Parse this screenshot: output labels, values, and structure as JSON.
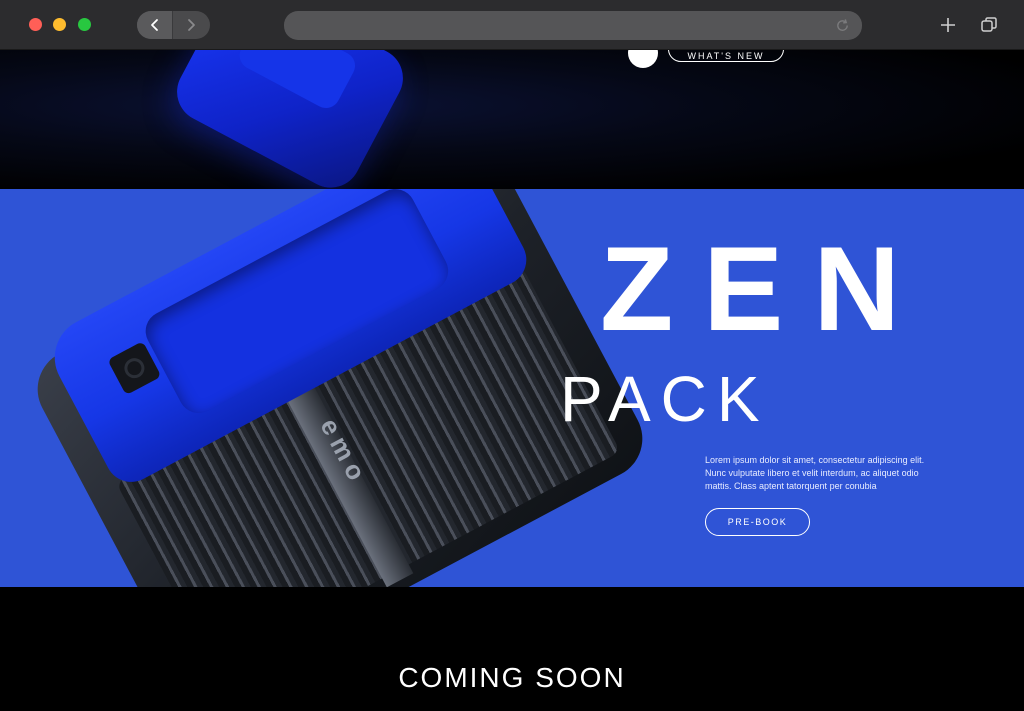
{
  "browser": {
    "back_icon": "chevron-left-icon",
    "forward_icon": "chevron-right-icon",
    "reload_icon": "reload-icon",
    "new_tab_icon": "plus-icon",
    "tabs_icon": "tabs-overview-icon"
  },
  "top_section": {
    "nav_pill_label": "WHAT'S NEW"
  },
  "hero": {
    "title_main": "ZEN",
    "title_sub": "PACK",
    "description": "Lorem ipsum dolor sit amet, consectetur adipiscing elit. Nunc vulputate libero et velit interdum, ac aliquet odio mattis. Class aptent tatorquent per conubia",
    "cta_label": "PRE-BOOK",
    "device_logo": "emo",
    "background_color": "#2f54d6",
    "accent_color": "#1b3bff"
  },
  "footer": {
    "coming_soon": "COMING SOON"
  }
}
